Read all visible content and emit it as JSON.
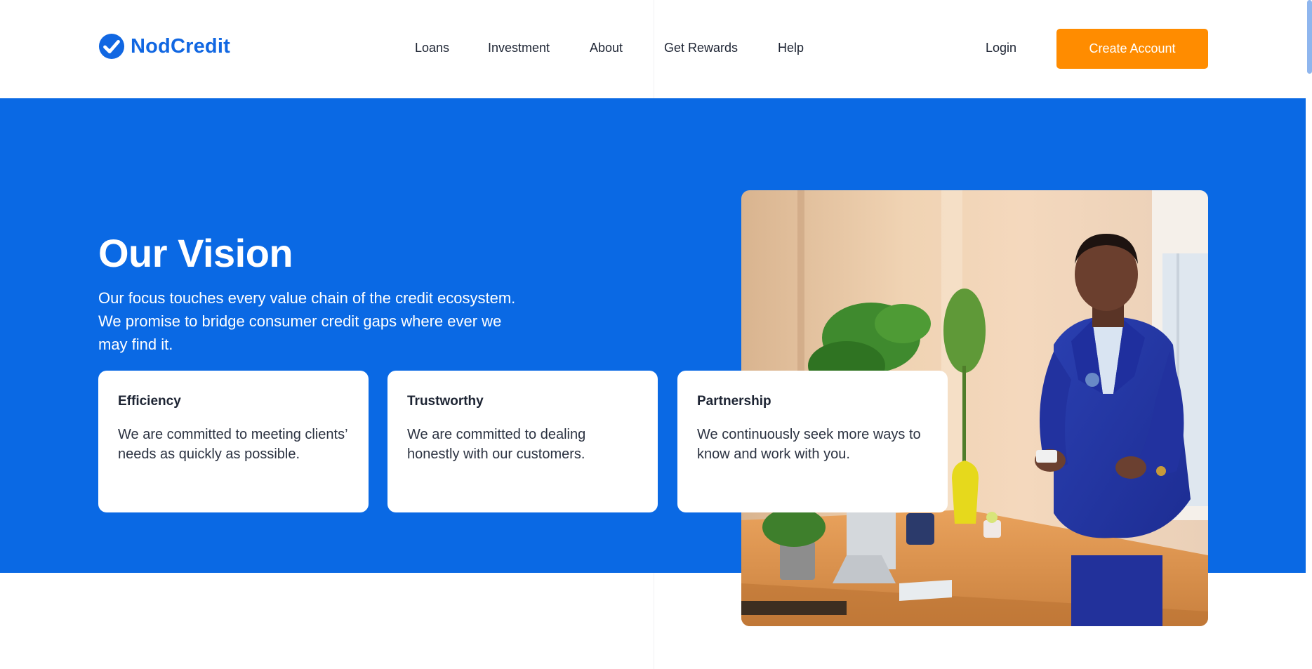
{
  "brand": {
    "name": "NodCredit",
    "color": "#1167e2"
  },
  "nav": {
    "items": [
      {
        "label": "Loans"
      },
      {
        "label": "Investment"
      },
      {
        "label": "About"
      },
      {
        "label": "Get Rewards"
      },
      {
        "label": "Help"
      }
    ]
  },
  "header": {
    "login_label": "Login",
    "cta_label": "Create Account",
    "cta_color": "#ff8c00"
  },
  "hero": {
    "background": "#0a69e4",
    "title": "Our Vision",
    "description": "Our focus touches every value chain of the credit ecosystem. We promise to bridge consumer credit gaps where ever we may find it."
  },
  "values": [
    {
      "title": "Efficiency",
      "text": "We are committed to meeting clients’ needs as quickly as possible."
    },
    {
      "title": "Trustworthy",
      "text": "We are committed to dealing honestly with our customers."
    },
    {
      "title": "Partnership",
      "text": "We continuously seek more ways to know and work with you."
    }
  ],
  "photo": {
    "icon": "man-with-phone-photo"
  }
}
